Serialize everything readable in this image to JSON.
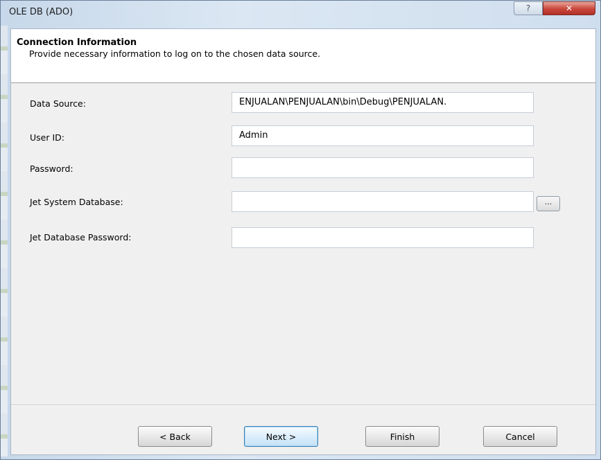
{
  "window": {
    "title": "OLE DB (ADO)",
    "help_glyph": "?",
    "close_glyph": "✕"
  },
  "header": {
    "title": "Connection Information",
    "subtitle": "Provide necessary information to log on to the chosen data source."
  },
  "fields": {
    "data_source": {
      "label": "Data Source:",
      "value": "ENJUALAN\\PENJUALAN\\bin\\Debug\\PENJUALAN."
    },
    "user_id": {
      "label": "User ID:",
      "value": "Admin"
    },
    "password": {
      "label": "Password:",
      "value": ""
    },
    "jet_system_db": {
      "label": "Jet System Database:",
      "value": "",
      "browse_label": "..."
    },
    "jet_db_password": {
      "label": "Jet Database Password:",
      "value": ""
    }
  },
  "buttons": {
    "back": "< Back",
    "next": "Next >",
    "finish": "Finish",
    "cancel": "Cancel"
  }
}
